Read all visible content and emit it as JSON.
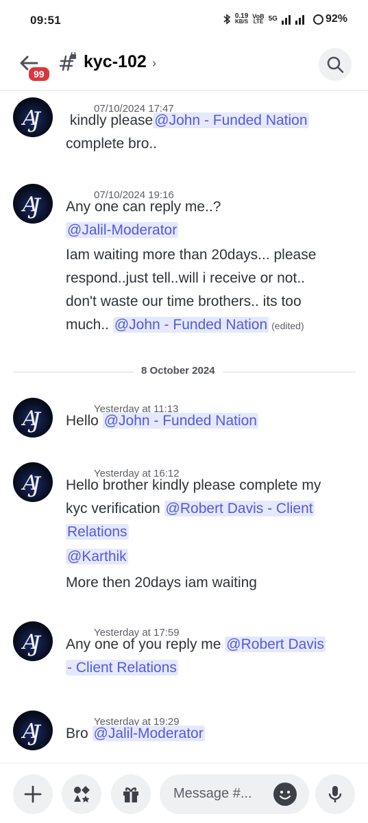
{
  "status_bar": {
    "time": "09:51",
    "data_speed": "0.19",
    "data_unit": "KB/S",
    "volte": "VoB",
    "lte": "LTE",
    "network": "5G",
    "battery": "92%"
  },
  "header": {
    "badge_count": "99",
    "channel_name": "kyc-102",
    "chevron": "›"
  },
  "messages": [
    {
      "timestamp": "07/10/2024 17:47",
      "lines": [
        {
          "mention": "@John - Funded Nation",
          "text": " kindly please"
        },
        {
          "text": "complete bro.."
        }
      ]
    },
    {
      "timestamp": "07/10/2024 19:16",
      "lines": [
        {
          "text": "Any one can reply me..?"
        },
        {
          "mention": "@Jalil-Moderator"
        },
        {
          "text": "Iam waiting more than 20days... please"
        },
        {
          "text": "respond..just tell..will i receive or not.."
        },
        {
          "text": "don't waste our time brothers.. its too"
        },
        {
          "text": "much.. ",
          "mention": "@John - Funded Nation",
          "edited": "(edited)"
        }
      ]
    },
    {
      "timestamp": "Yesterday at 11:13",
      "lines": [
        {
          "text": "Hello ",
          "mention": "@John - Funded Nation"
        }
      ]
    },
    {
      "timestamp": "Yesterday at 16:12",
      "lines": [
        {
          "text": "Hello brother kindly please complete my"
        },
        {
          "text": "kyc verification ",
          "mention": "@Robert Davis - Client"
        },
        {
          "mention": "Relations"
        },
        {
          "mention": "@Karthik"
        },
        {
          "text": "More then 20days iam waiting"
        }
      ]
    },
    {
      "timestamp": "Yesterday at 17:59",
      "lines": [
        {
          "text": "Any one of you reply me ",
          "mention": "@Robert Davis"
        },
        {
          "mention": "- Client Relations"
        }
      ]
    },
    {
      "timestamp": "Yesterday at 19:29",
      "lines": [
        {
          "text": "Bro ",
          "mention": "@Jalil-Moderator"
        }
      ]
    }
  ],
  "date_divider": "8 October 2024",
  "composer": {
    "placeholder": "Message #...",
    "icons": [
      "plus-icon",
      "apps-icon",
      "gift-icon",
      "emoji-icon",
      "microphone-icon"
    ]
  },
  "colors": {
    "mention_bg": "#e6e8fd",
    "mention_text": "#505cdc",
    "badge": "#da373c"
  }
}
